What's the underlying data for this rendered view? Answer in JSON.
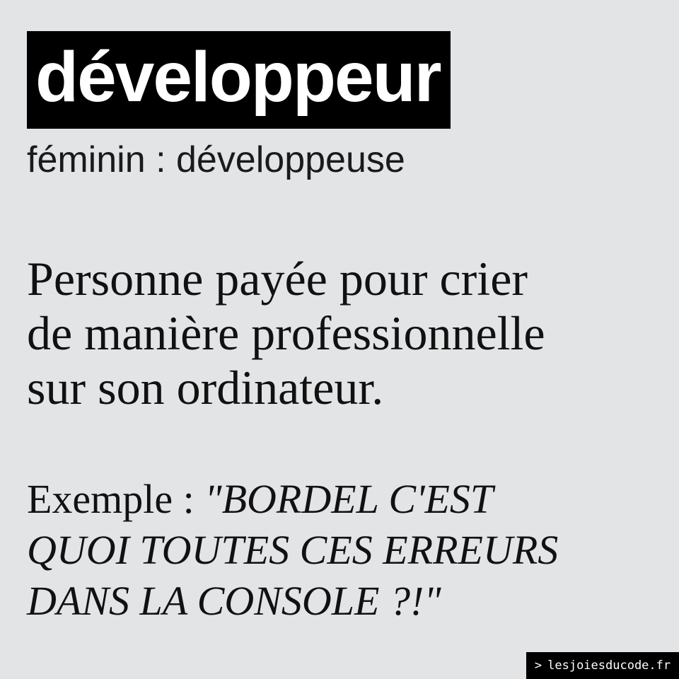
{
  "headword": "développeur",
  "feminine": "féminin : développeuse",
  "definition": {
    "lines": [
      "Personne payée pour crier",
      "de manière professionnelle",
      "sur son ordinateur."
    ]
  },
  "example": {
    "label": "Exemple : ",
    "quote_lines": [
      "\"BORDEL C'EST",
      "QUOI TOUTES CES ERREURS",
      "DANS LA CONSOLE ?!\""
    ]
  },
  "badge": {
    "prompt": ">",
    "site": "lesjoiesducode.fr"
  },
  "colors": {
    "background": "#e3e4e6",
    "headword_bg": "#000000",
    "headword_text": "#ffffff"
  }
}
